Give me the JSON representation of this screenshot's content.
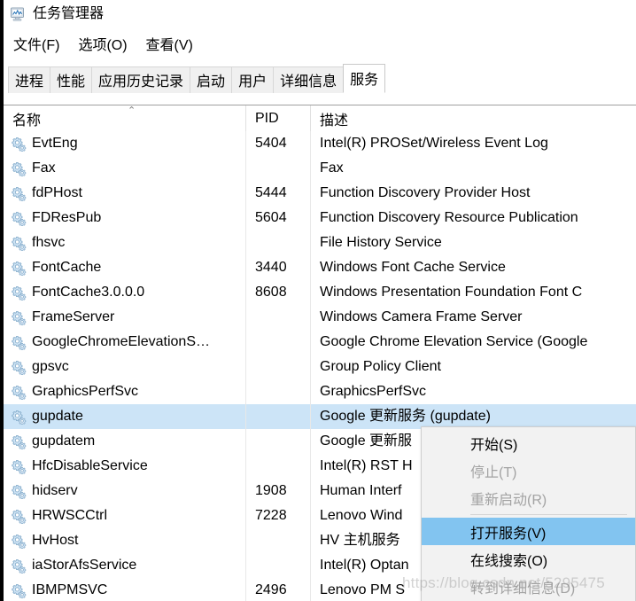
{
  "window": {
    "title": "任务管理器",
    "icon": "task-manager-icon"
  },
  "menubar": {
    "items": [
      {
        "label": "文件(F)"
      },
      {
        "label": "选项(O)"
      },
      {
        "label": "查看(V)"
      }
    ]
  },
  "tabs": [
    {
      "label": "进程",
      "active": false
    },
    {
      "label": "性能",
      "active": false
    },
    {
      "label": "应用历史记录",
      "active": false
    },
    {
      "label": "启动",
      "active": false
    },
    {
      "label": "用户",
      "active": false
    },
    {
      "label": "详细信息",
      "active": false
    },
    {
      "label": "服务",
      "active": true
    }
  ],
  "table": {
    "columns": {
      "name": "名称",
      "pid": "PID",
      "description": "描述"
    },
    "sort": {
      "column": "名称",
      "direction": "ascending",
      "caret": "⌃"
    },
    "rows": [
      {
        "name": "EvtEng",
        "pid": "5404",
        "description": "Intel(R) PROSet/Wireless Event Log",
        "selected": false
      },
      {
        "name": "Fax",
        "pid": "",
        "description": "Fax",
        "selected": false
      },
      {
        "name": "fdPHost",
        "pid": "5444",
        "description": "Function Discovery Provider Host",
        "selected": false
      },
      {
        "name": "FDResPub",
        "pid": "5604",
        "description": "Function Discovery Resource Publication",
        "selected": false
      },
      {
        "name": "fhsvc",
        "pid": "",
        "description": "File History Service",
        "selected": false
      },
      {
        "name": "FontCache",
        "pid": "3440",
        "description": "Windows Font Cache Service",
        "selected": false
      },
      {
        "name": "FontCache3.0.0.0",
        "pid": "8608",
        "description": "Windows Presentation Foundation Font C",
        "selected": false
      },
      {
        "name": "FrameServer",
        "pid": "",
        "description": "Windows Camera Frame Server",
        "selected": false
      },
      {
        "name": "GoogleChromeElevationS…",
        "pid": "",
        "description": "Google Chrome Elevation Service (Google",
        "selected": false
      },
      {
        "name": "gpsvc",
        "pid": "",
        "description": "Group Policy Client",
        "selected": false
      },
      {
        "name": "GraphicsPerfSvc",
        "pid": "",
        "description": "GraphicsPerfSvc",
        "selected": false
      },
      {
        "name": "gupdate",
        "pid": "",
        "description": "Google 更新服务 (gupdate)",
        "selected": true
      },
      {
        "name": "gupdatem",
        "pid": "",
        "description": "Google 更新服",
        "selected": false
      },
      {
        "name": "HfcDisableService",
        "pid": "",
        "description": "Intel(R) RST H",
        "selected": false
      },
      {
        "name": "hidserv",
        "pid": "1908",
        "description": "Human Interf",
        "selected": false
      },
      {
        "name": "HRWSCCtrl",
        "pid": "7228",
        "description": "Lenovo Wind",
        "selected": false
      },
      {
        "name": "HvHost",
        "pid": "",
        "description": "HV 主机服务",
        "selected": false
      },
      {
        "name": "iaStorAfsService",
        "pid": "",
        "description": "Intel(R) Optan",
        "selected": false
      },
      {
        "name": "IBMPMSVC",
        "pid": "2496",
        "description": "Lenovo PM S",
        "selected": false
      }
    ]
  },
  "context_menu": {
    "items": [
      {
        "label": "开始(S)",
        "state": "enabled",
        "separator_after": false
      },
      {
        "label": "停止(T)",
        "state": "disabled",
        "separator_after": false
      },
      {
        "label": "重新启动(R)",
        "state": "disabled",
        "separator_after": true
      },
      {
        "label": "打开服务(V)",
        "state": "highlight",
        "separator_after": false
      },
      {
        "label": "在线搜索(O)",
        "state": "enabled",
        "separator_after": false
      },
      {
        "label": "转到详细信息(D)",
        "state": "disabled",
        "separator_after": false
      }
    ]
  },
  "watermark": {
    "text": "https://blog.csdn.net/5295475"
  },
  "colors": {
    "selection_row": "#cce4f7",
    "menu_highlight": "#82c4f0",
    "tab_inactive": "#f0f0f0",
    "tab_active": "#ffffff",
    "text": "#000000",
    "text_disabled": "#a3a3a3"
  }
}
